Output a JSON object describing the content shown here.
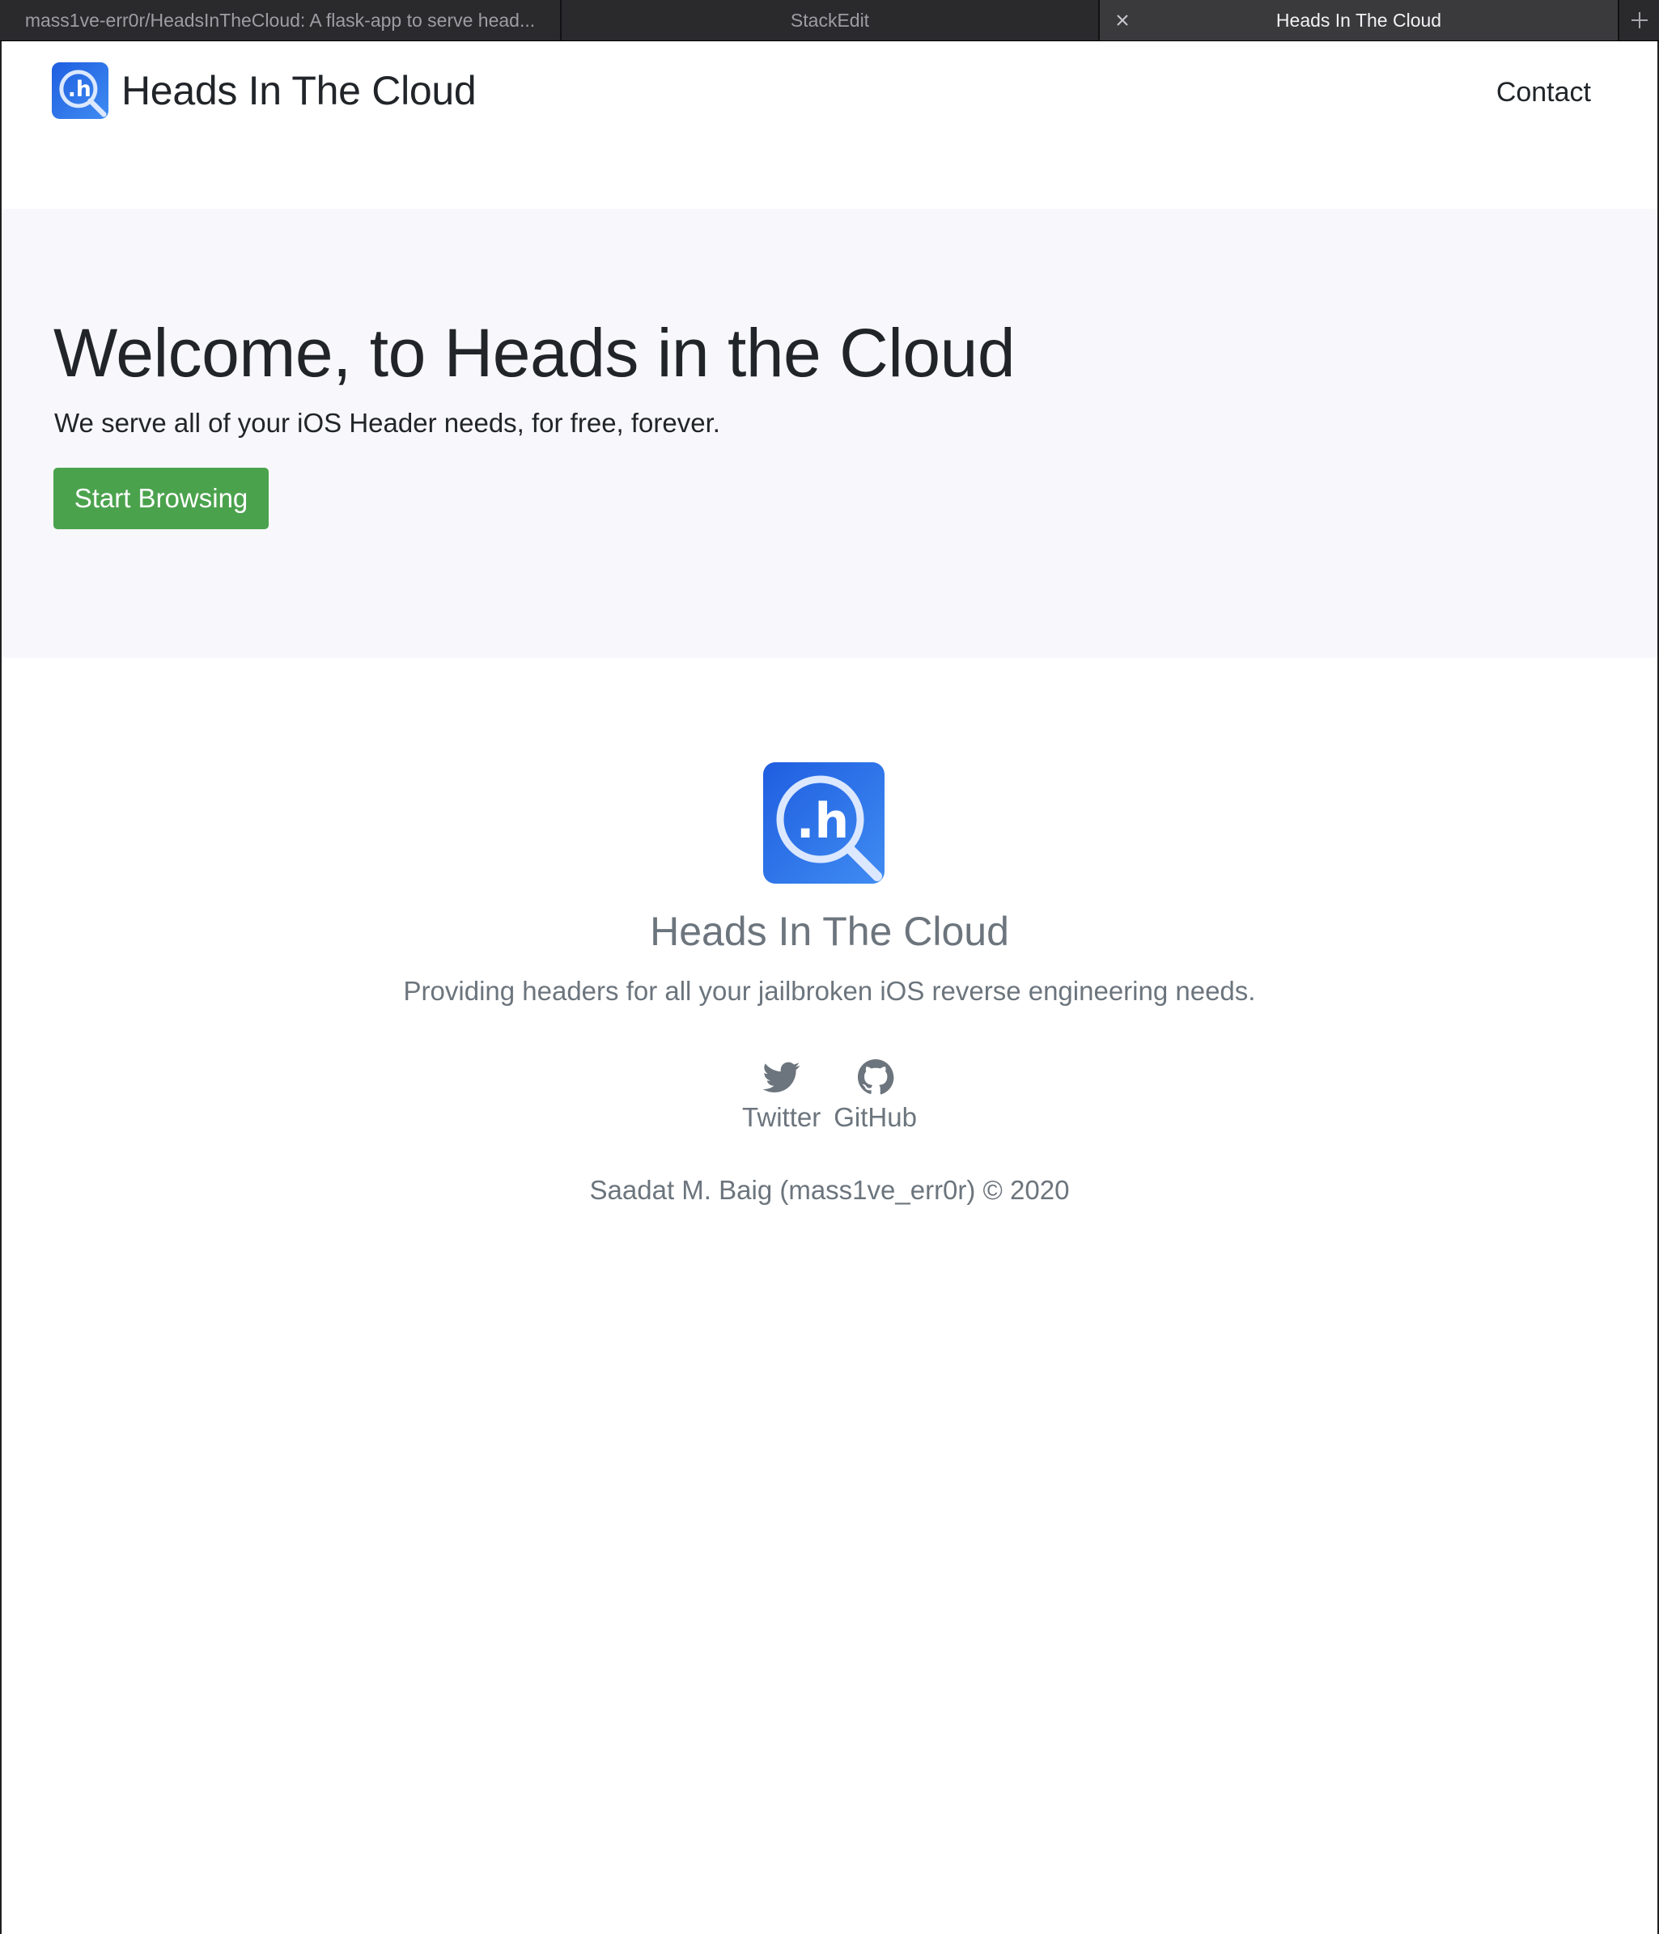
{
  "browser": {
    "tabs": [
      {
        "label": "mass1ve-err0r/HeadsInTheCloud: A flask-app to serve head..."
      },
      {
        "label": "StackEdit"
      },
      {
        "label": "Heads In The Cloud",
        "active": true
      }
    ]
  },
  "navbar": {
    "brand": "Heads In The Cloud",
    "contact": "Contact"
  },
  "hero": {
    "title": "Welcome, to Heads in the Cloud",
    "lead": "We serve all of your iOS Header needs, for free, forever.",
    "button": "Start Browsing"
  },
  "footer": {
    "title": "Heads In The Cloud",
    "tagline": "Providing headers for all your jailbroken iOS reverse engineering needs.",
    "social": [
      {
        "label": "Twitter",
        "icon": "twitter-icon"
      },
      {
        "label": "GitHub",
        "icon": "github-icon"
      }
    ],
    "copyright": "Saadat M. Baig (mass1ve_err0r) © 2020"
  },
  "colors": {
    "accent_button": "#4ba24d",
    "logo_blue": "#1f5fe0",
    "hero_bg": "#f8f8fc",
    "muted_text": "#6c757d"
  }
}
